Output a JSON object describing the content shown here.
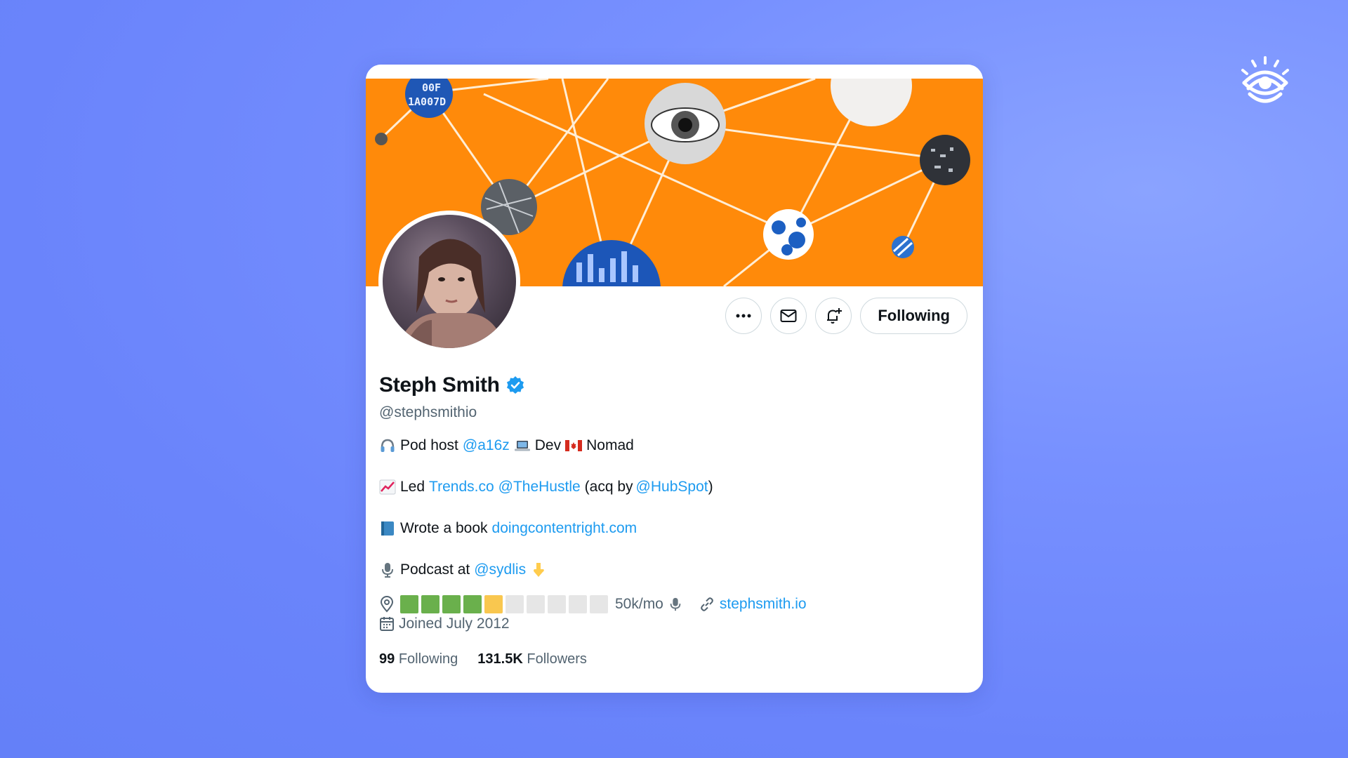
{
  "profile": {
    "name": "Steph Smith",
    "handle": "@stephsmithio",
    "follow_button": "Following",
    "bio": {
      "line1": {
        "text1": "Pod host",
        "link1": "@a16z",
        "text2": "Dev",
        "text3": "Nomad"
      },
      "line2": {
        "text1": "Led",
        "link1": "Trends.co",
        "link2": "@TheHustle",
        "text2": "(acq by",
        "link3": "@HubSpot",
        "text3": ")"
      },
      "line3": {
        "text1": "Wrote a book",
        "link1": "doingcontentright.com"
      },
      "line4": {
        "text1": "Podcast at",
        "link1": "@sydlis"
      }
    },
    "location": {
      "progress_filled": 5,
      "progress_total": 10,
      "text": "50k/mo"
    },
    "website": "stephsmith.io",
    "joined": "Joined July 2012",
    "stats": {
      "following_count": "99",
      "following_label": "Following",
      "followers_count": "131.5K",
      "followers_label": "Followers"
    }
  },
  "icons": {
    "more": "more-icon",
    "message": "mail-icon",
    "notify": "bell-plus-icon",
    "verified": "verified-badge-icon",
    "location": "location-pin-icon",
    "link": "link-icon",
    "calendar": "calendar-icon",
    "microphone": "microphone-icon"
  },
  "colors": {
    "banner": "#ff8a0a",
    "link": "#1d9bf0",
    "muted": "#536471",
    "bar_green": "#6ab04c",
    "bar_yellow": "#f9c74f",
    "bar_empty": "#e6e6e6"
  }
}
